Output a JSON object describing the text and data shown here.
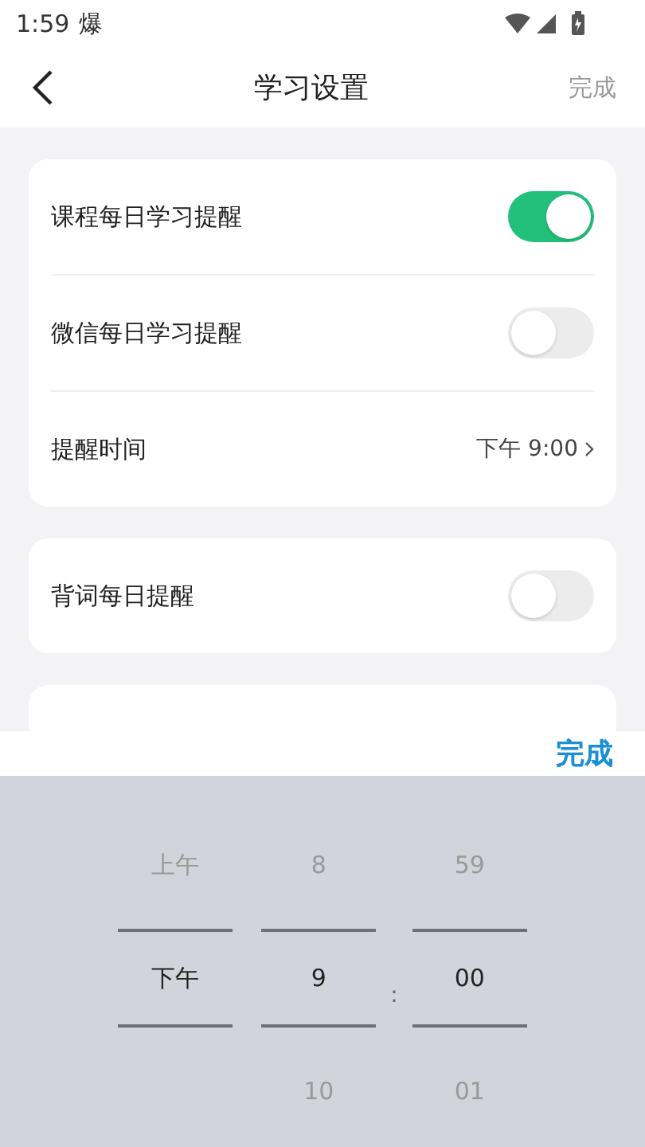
{
  "status_bar": {
    "time": "1:59",
    "notification": "爆"
  },
  "header": {
    "title": "学习设置",
    "action": "完成"
  },
  "groups": [
    {
      "rows": [
        {
          "kind": "toggle",
          "label": "课程每日学习提醒",
          "on": true
        },
        {
          "kind": "toggle",
          "label": "微信每日学习提醒",
          "on": false
        },
        {
          "kind": "value",
          "label": "提醒时间",
          "value": "下午 9:00"
        }
      ]
    },
    {
      "rows": [
        {
          "kind": "toggle",
          "label": "背词每日提醒",
          "on": false
        }
      ]
    }
  ],
  "picker": {
    "done": "完成",
    "separator": ":",
    "columns": [
      {
        "items": [
          {
            "label": "上午",
            "selected": false
          },
          {
            "label": "下午",
            "selected": true
          }
        ]
      },
      {
        "items": [
          {
            "label": "8",
            "selected": false
          },
          {
            "label": "9",
            "selected": true
          },
          {
            "label": "10",
            "selected": false
          }
        ]
      },
      {
        "items": [
          {
            "label": "59",
            "selected": false
          },
          {
            "label": "00",
            "selected": true
          },
          {
            "label": "01",
            "selected": false
          }
        ]
      }
    ]
  }
}
